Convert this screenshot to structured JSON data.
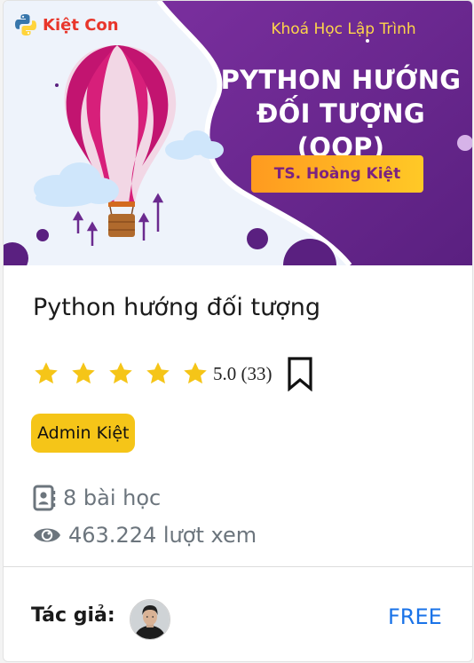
{
  "banner": {
    "brand": "Kiệt Con",
    "subtitle": "Khoá Học Lập Trình",
    "title_line1": "PYTHON HƯỚNG",
    "title_line2": "ĐỐI TƯỢNG (OOP)",
    "author_button": "TS. Hoàng Kiệt",
    "colors": {
      "purple": "#6b2a8f",
      "gold": "#ffd54a",
      "brand_red": "#e8362b"
    }
  },
  "course": {
    "title": "Python hướng đối tượng",
    "rating_stars": 5,
    "rating_text": "5.0 (33)",
    "instructor_badge": "Admin Kiệt",
    "lessons": "8 bài học",
    "views": "463.224 lượt xem"
  },
  "footer": {
    "author_label": "Tác giả:",
    "price": "FREE",
    "price_color": "#1a73e8"
  },
  "icons": [
    "python-logo-icon",
    "star-icon",
    "bookmark-icon",
    "contact-book-icon",
    "eye-icon"
  ]
}
